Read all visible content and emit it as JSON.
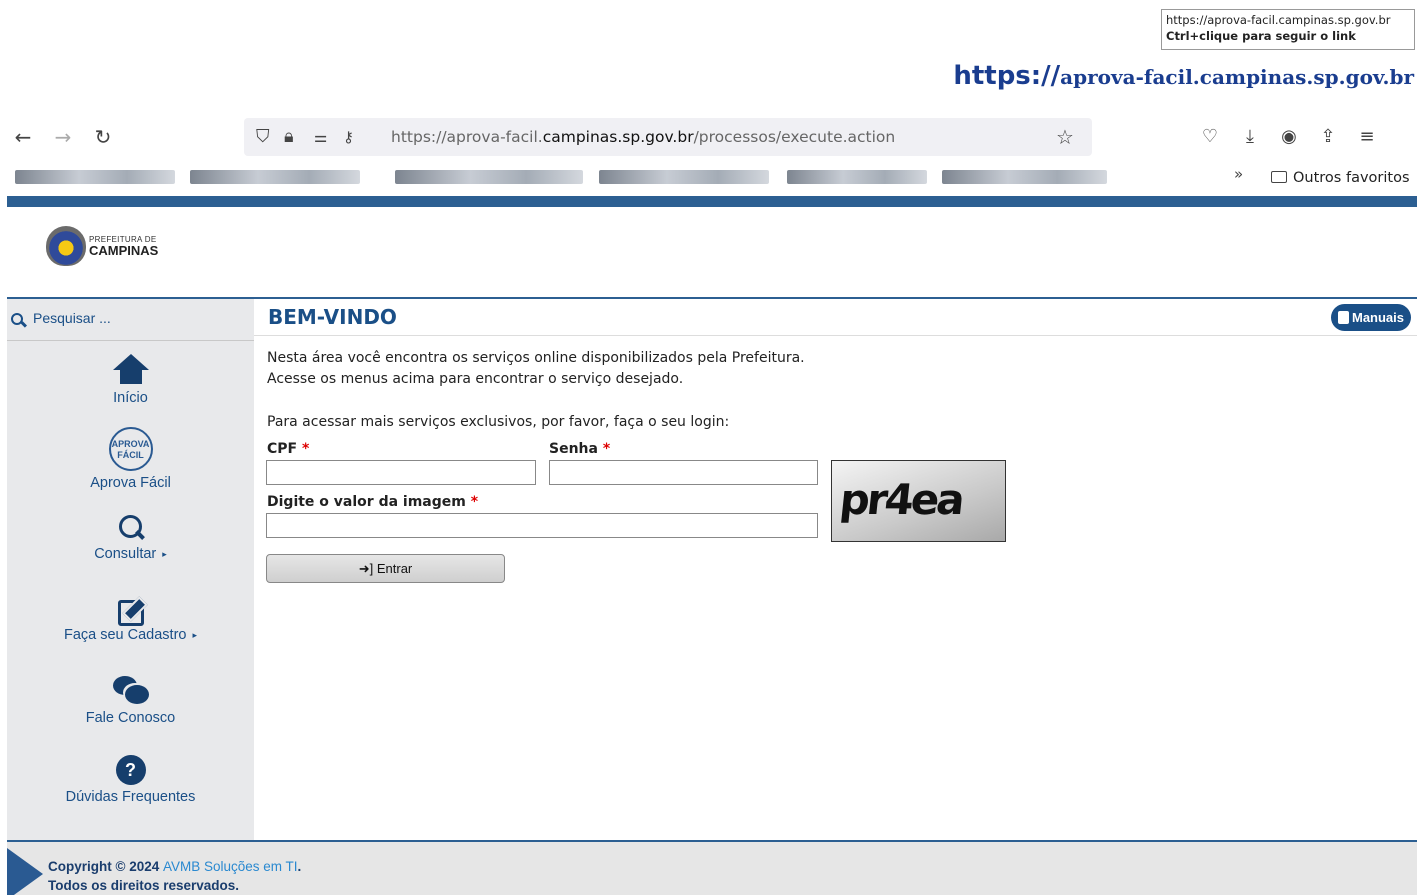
{
  "tooltip": {
    "url": "https://aprova-facil.campinas.sp.gov.br",
    "hint": "Ctrl+clique para seguir o link"
  },
  "link_heading": {
    "protocol": "https://",
    "host": "aprova-facil.campinas.sp.gov.br"
  },
  "browser": {
    "back_icon": "arrow-left-icon",
    "forward_icon": "arrow-right-icon",
    "reload_icon": "reload-icon",
    "url_prefix": "https://aprova-facil.",
    "url_domain": "campinas.sp.gov.br",
    "url_path": "/processos/execute.action",
    "bookmarks_more": "»",
    "other_bookmarks": "Outros favoritos"
  },
  "logo": {
    "line1": "PREFEITURA DE",
    "line2": "CAMPINAS"
  },
  "sidebar": {
    "search_placeholder": "Pesquisar ...",
    "items": [
      {
        "label": "Início",
        "icon": "home-icon"
      },
      {
        "label": "Aprova Fácil",
        "icon": "aprova-facil-logo",
        "icon_text": "APROVA FÁCIL"
      },
      {
        "label": "Consultar",
        "icon": "search-icon",
        "arrow": "▸"
      },
      {
        "label": "Faça seu Cadastro",
        "icon": "edit-icon",
        "arrow": "▸"
      },
      {
        "label": "Fale Conosco",
        "icon": "chat-icon"
      },
      {
        "label": "Dúvidas Frequentes",
        "icon": "question-icon",
        "icon_text": "?"
      }
    ]
  },
  "main": {
    "title": "BEM-VINDO",
    "manuais": "Manuais",
    "intro1": "Nesta área você encontra os serviços online disponibilizados pela Prefeitura.",
    "intro2": "Acesse os menus acima para encontrar o serviço desejado.",
    "login_prompt": "Para acessar mais serviços exclusivos, por favor, faça o seu login:",
    "cpf_label": "CPF",
    "senha_label": "Senha",
    "captcha_label": "Digite o valor da imagem",
    "required_mark": "*",
    "captcha_text": "pr4ea",
    "entrar_icon": "➜]",
    "entrar_label": "Entrar"
  },
  "footer": {
    "copyright": "Copyright © 2024 ",
    "company": "AVMB Soluções em TI",
    "period": ".",
    "rights": "Todos os direitos reservados."
  },
  "colors": {
    "brand_blue": "#1a4f87",
    "top_bar": "#2c5f92",
    "required": "#dd0000",
    "footer_link": "#2a89d0"
  }
}
